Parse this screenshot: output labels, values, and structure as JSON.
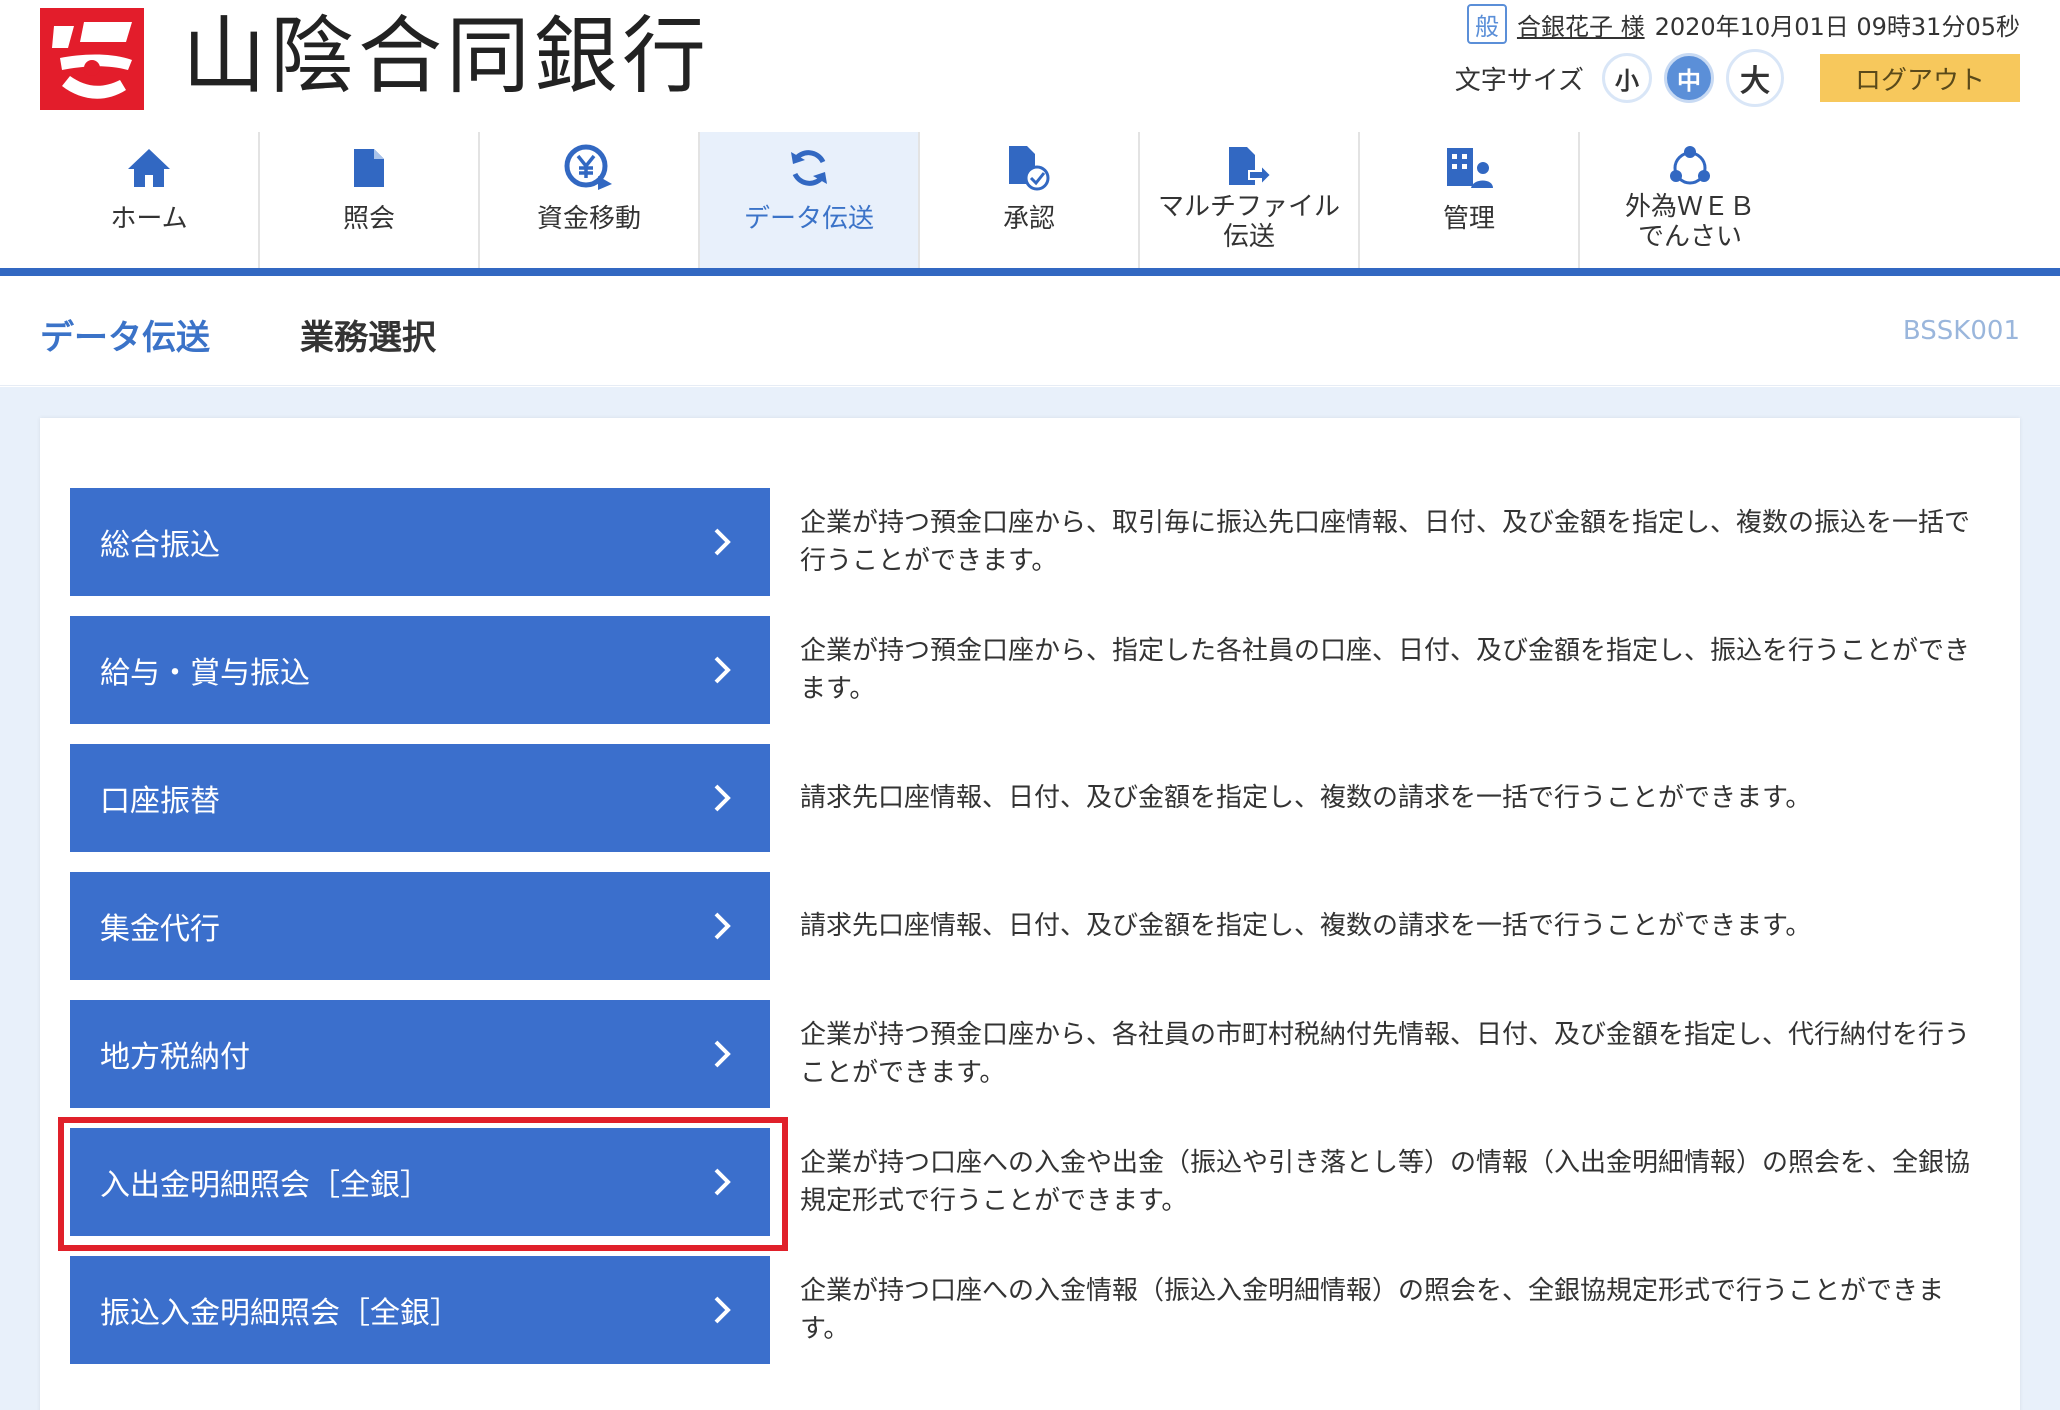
{
  "bank": {
    "name": "山陰合同銀行"
  },
  "user": {
    "badge": "般",
    "name": "合銀花子 様",
    "datetime": "2020年10月01日 09時31分05秒"
  },
  "font_size": {
    "label": "文字サイズ",
    "small": "小",
    "medium": "中",
    "large": "大",
    "selected": "中"
  },
  "logout_label": "ログアウト",
  "nav": {
    "items": [
      {
        "label": "ホーム",
        "icon": "home-icon"
      },
      {
        "label": "照会",
        "icon": "document-icon"
      },
      {
        "label": "資金移動",
        "icon": "yen-transfer-icon"
      },
      {
        "label": "データ伝送",
        "icon": "sync-icon",
        "active": true
      },
      {
        "label": "承認",
        "icon": "approve-document-icon"
      },
      {
        "label": "マルチファイル\n伝送",
        "icon": "file-transfer-icon"
      },
      {
        "label": "管理",
        "icon": "management-icon"
      },
      {
        "label": "外為ＷＥＢ\nでんさい",
        "icon": "network-icon"
      }
    ]
  },
  "page": {
    "category": "データ伝送",
    "title": "業務選択",
    "screen_id": "BSSK001"
  },
  "menus": [
    {
      "label": "総合振込",
      "description": "企業が持つ預金口座から、取引毎に振込先口座情報、日付、及び金額を指定し、複数の振込を一括で行うことができます。"
    },
    {
      "label": "給与・賞与振込",
      "description": "企業が持つ預金口座から、指定した各社員の口座、日付、及び金額を指定し、振込を行うことができます。"
    },
    {
      "label": "口座振替",
      "description": "請求先口座情報、日付、及び金額を指定し、複数の請求を一括で行うことができます。"
    },
    {
      "label": "集金代行",
      "description": "請求先口座情報、日付、及び金額を指定し、複数の請求を一括で行うことができます。"
    },
    {
      "label": "地方税納付",
      "description": "企業が持つ預金口座から、各社員の市町村税納付先情報、日付、及び金額を指定し、代行納付を行うことができます。"
    },
    {
      "label": "入出金明細照会［全銀］",
      "description": "企業が持つ口座への入金や出金（振込や引き落とし等）の情報（入出金明細情報）の照会を、全銀協規定形式で行うことができます。",
      "highlighted": true
    },
    {
      "label": "振込入金明細照会［全銀］",
      "description": "企業が持つ口座への入金情報（振込入金明細情報）の照会を、全銀協規定形式で行うことができます。"
    }
  ],
  "colors": {
    "primary": "#3b6fcc",
    "nav_bar": "#3268c2",
    "logout": "#f7c85c",
    "highlight": "#e0202a",
    "logo_red": "#e31d2b"
  }
}
